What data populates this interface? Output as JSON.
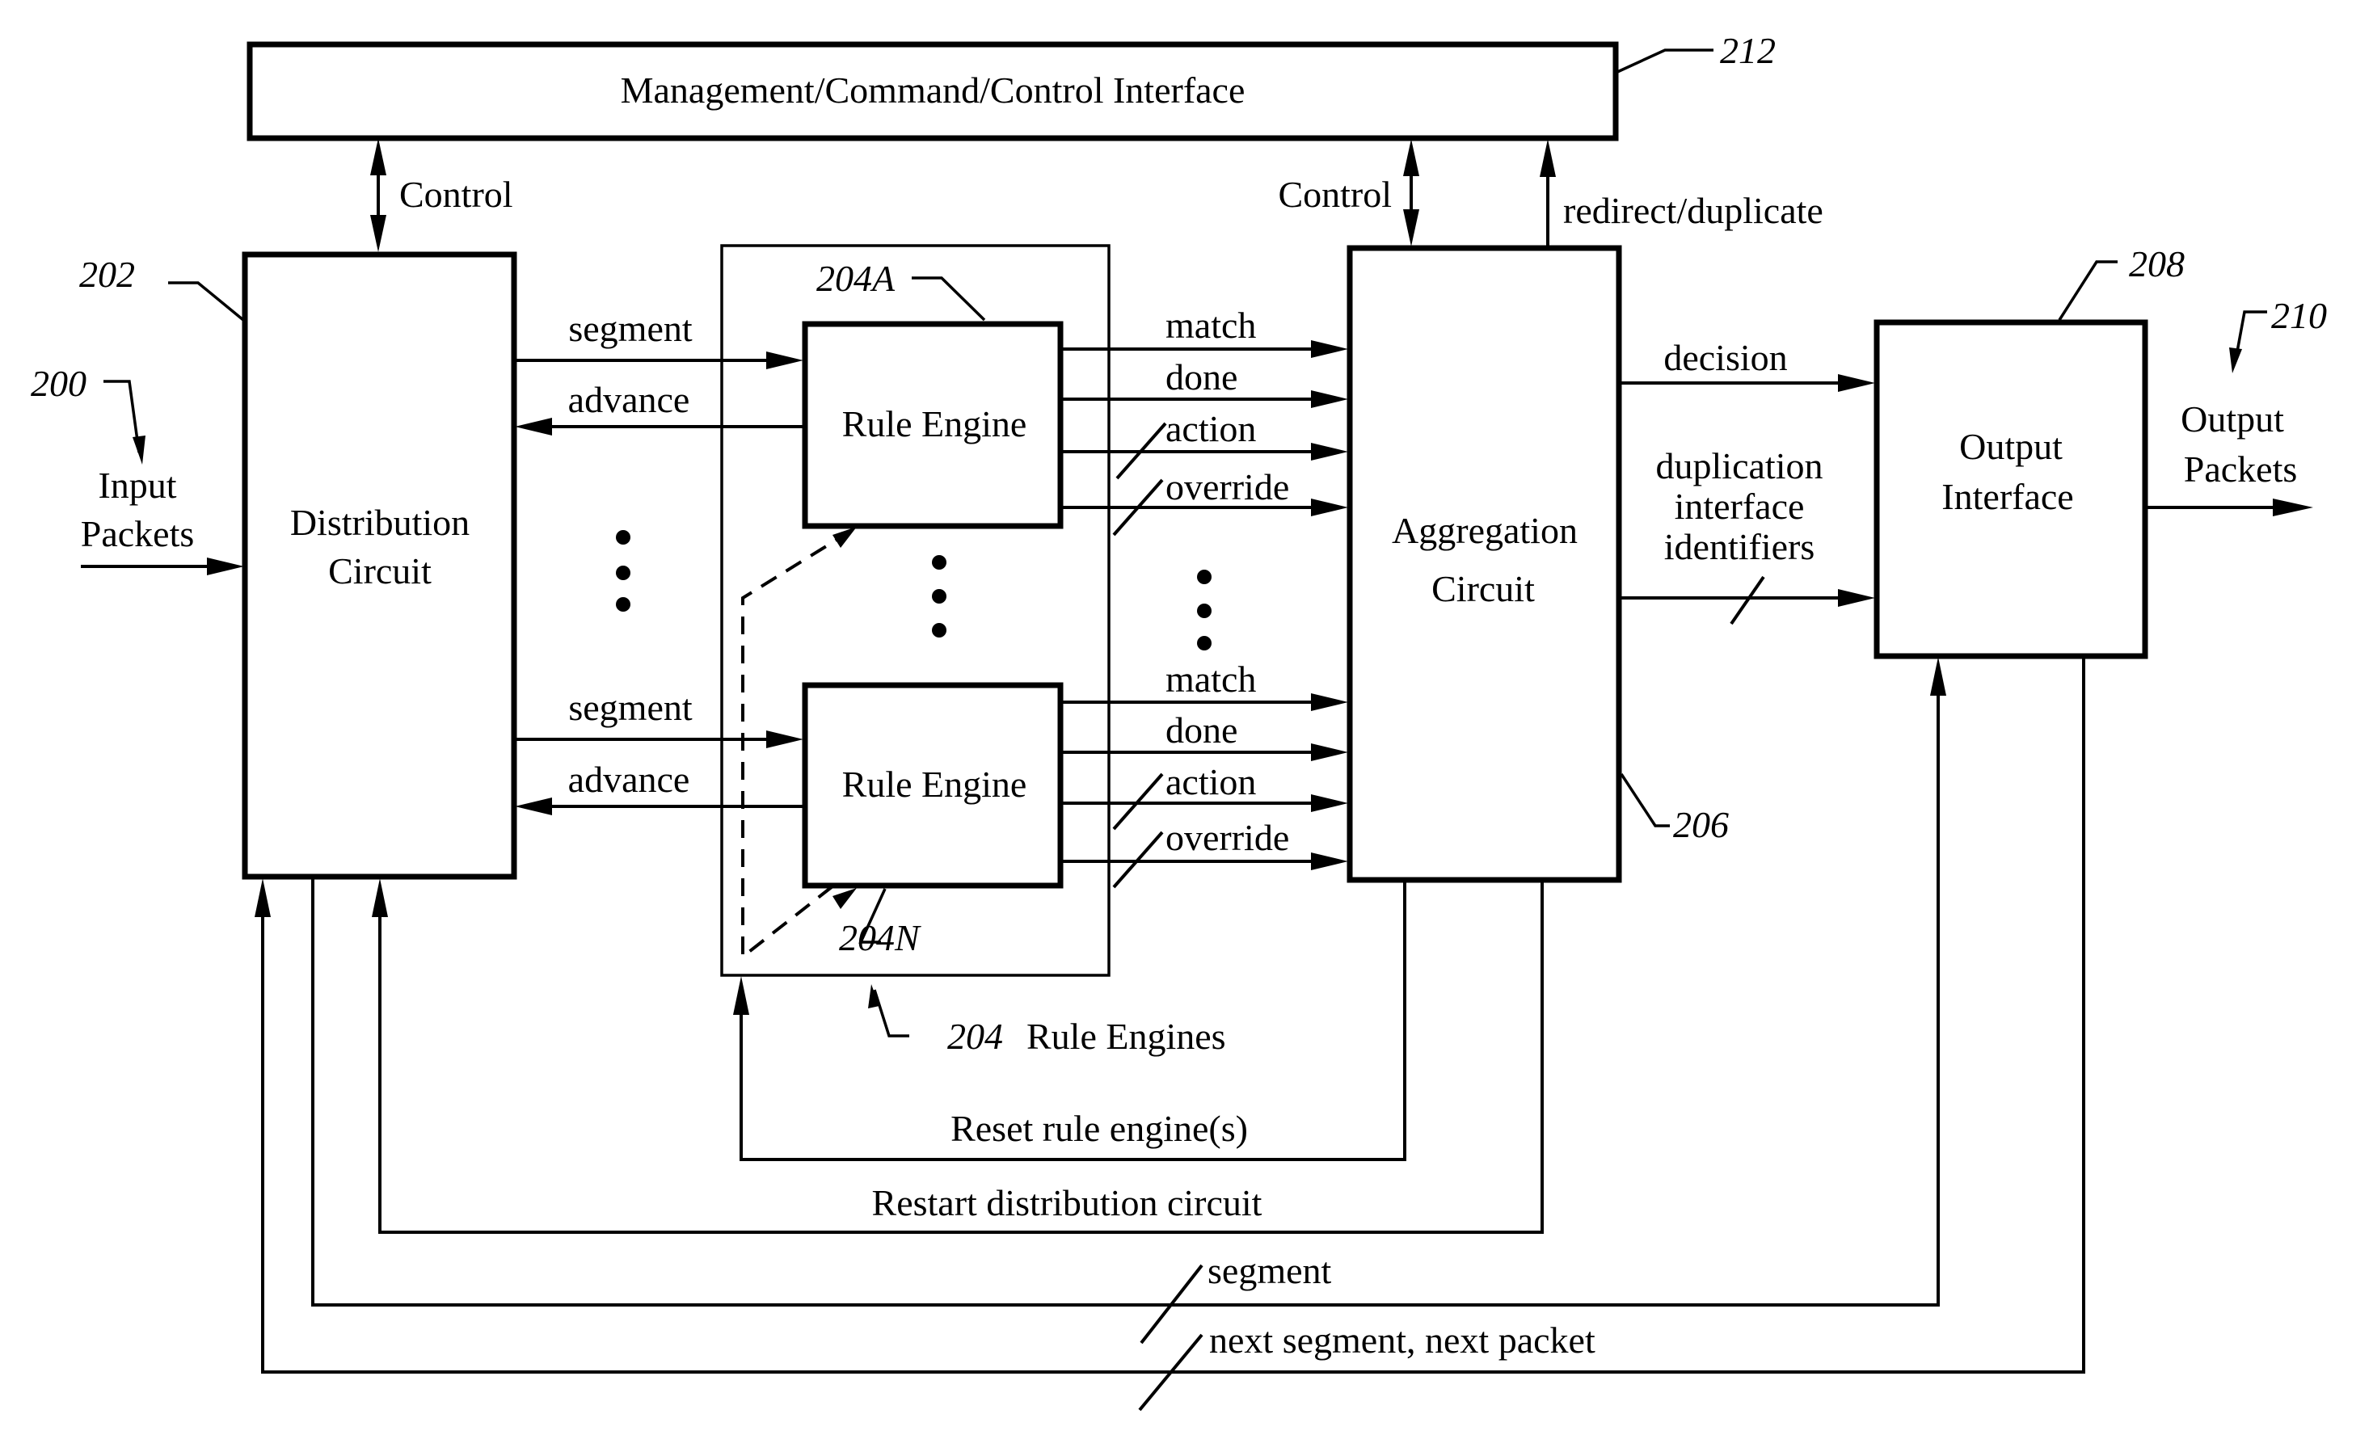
{
  "diagram": {
    "blocks": {
      "management": {
        "label": "Management/Command/Control Interface",
        "ref": "212"
      },
      "distribution": {
        "label_line1": "Distribution",
        "label_line2": "Circuit",
        "ref": "202"
      },
      "rule_engines_group": {
        "ref": "204",
        "label": "Rule Engines"
      },
      "rule_engine_a": {
        "label": "Rule Engine",
        "ref": "204A"
      },
      "rule_engine_n": {
        "label": "Rule Engine",
        "ref": "204N"
      },
      "aggregation": {
        "label_line1": "Aggregation",
        "label_line2": "Circuit",
        "ref": "206"
      },
      "output": {
        "label_line1": "Output",
        "label_line2": "Interface",
        "ref": "208"
      }
    },
    "io": {
      "input": {
        "line1": "Input",
        "line2": "Packets",
        "ref": "200"
      },
      "output": {
        "line1": "Output",
        "line2": "Packets",
        "ref": "210"
      }
    },
    "signals": {
      "control_left": "Control",
      "control_right": "Control",
      "redirect": "redirect/duplicate",
      "segment_a": "segment",
      "advance_a": "advance",
      "segment_n": "segment",
      "advance_n": "advance",
      "match_a": "match",
      "done_a": "done",
      "action_a": "action",
      "override_a": "override",
      "match_n": "match",
      "done_n": "done",
      "action_n": "action",
      "override_n": "override",
      "decision": "decision",
      "dup_line1": "duplication",
      "dup_line2": "interface",
      "dup_line3": "identifiers",
      "reset": "Reset rule engine(s)",
      "restart": "Restart distribution circuit",
      "segment_bottom": "segment",
      "next": "next segment, next packet"
    }
  }
}
